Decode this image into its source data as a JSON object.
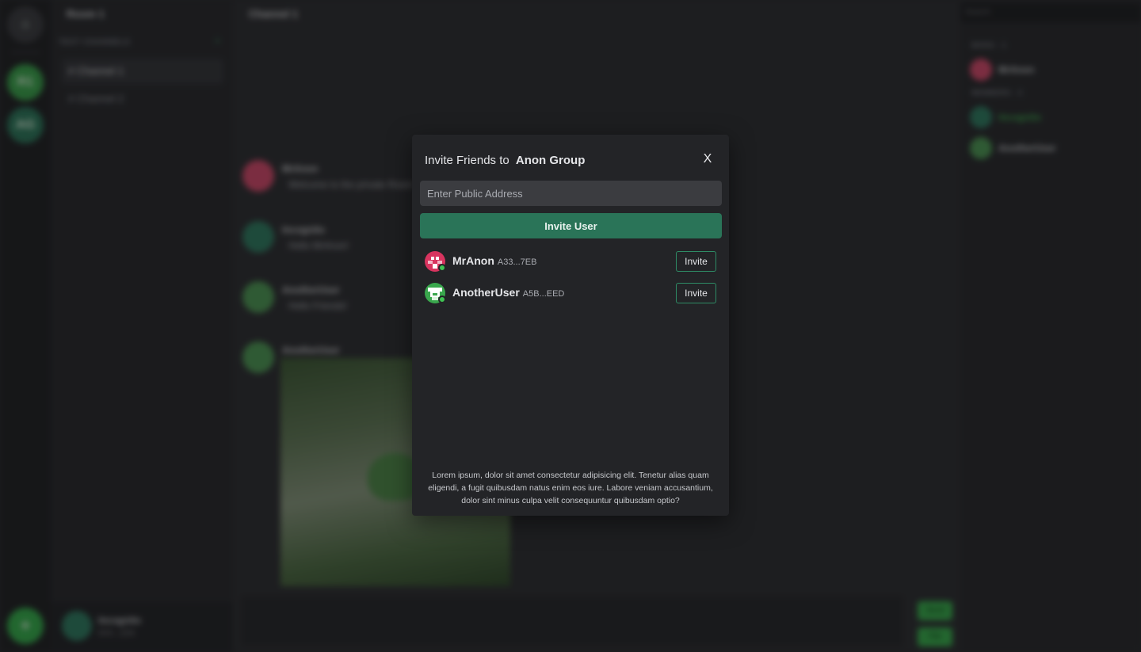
{
  "background": {
    "server_rail": {
      "home_label": "⌂",
      "r1_label": "R1",
      "anon_label": "AG",
      "add_label": "+"
    },
    "room_title": "Room 1",
    "channels_header": "TEXT CHANNELS",
    "channels_add": "+",
    "channels": [
      {
        "label": "# Channel 1"
      },
      {
        "label": "# Channel 2"
      }
    ],
    "current_user": {
      "name": "Incognito",
      "address": "0XX...ZZA"
    },
    "chat_title": "Channel 1",
    "messages": [
      {
        "author": "MrAnon",
        "text": "Welcome to the private Room"
      },
      {
        "author": "Incognito",
        "text": "Hello MrAnon!"
      },
      {
        "author": "AnotherUser",
        "text": "Hello Friends!"
      },
      {
        "author": "AnotherUser",
        "text": ""
      }
    ],
    "composer": {
      "send_label": "Send",
      "file_label": "File"
    },
    "members": {
      "search_placeholder": "Search",
      "mods_header": "MODS - 1",
      "members_header": "MEMBERS - 2",
      "mods": [
        {
          "name": "MrAnon"
        }
      ],
      "members": [
        {
          "name": "Incognito"
        },
        {
          "name": "AnotherUser"
        }
      ]
    }
  },
  "modal": {
    "title_prefix": "Invite Friends to",
    "group_name": "Anon Group",
    "close_label": "X",
    "address_placeholder": "Enter Public Address",
    "address_value": "",
    "invite_user_label": "Invite User",
    "friends": [
      {
        "name": "MrAnon",
        "address": "A33...7EB",
        "invite_label": "Invite",
        "avatar_color": "#d8345f",
        "status": "online"
      },
      {
        "name": "AnotherUser",
        "address": "A5B...EED",
        "invite_label": "Invite",
        "avatar_color": "#3aa74d",
        "status": "online"
      }
    ],
    "footer_text": "Lorem ipsum, dolor sit amet consectetur adipisicing elit. Tenetur alias quam eligendi, a fugit quibusdam natus enim eos iure. Labore veniam accusantium, dolor sint minus culpa velit consequuntur quibusdam optio?"
  },
  "colors": {
    "accent": "#2a7458",
    "accent_border": "#2e8b65",
    "online": "#3fc453",
    "modal_bg": "#232427",
    "input_bg": "#3b3c40"
  }
}
